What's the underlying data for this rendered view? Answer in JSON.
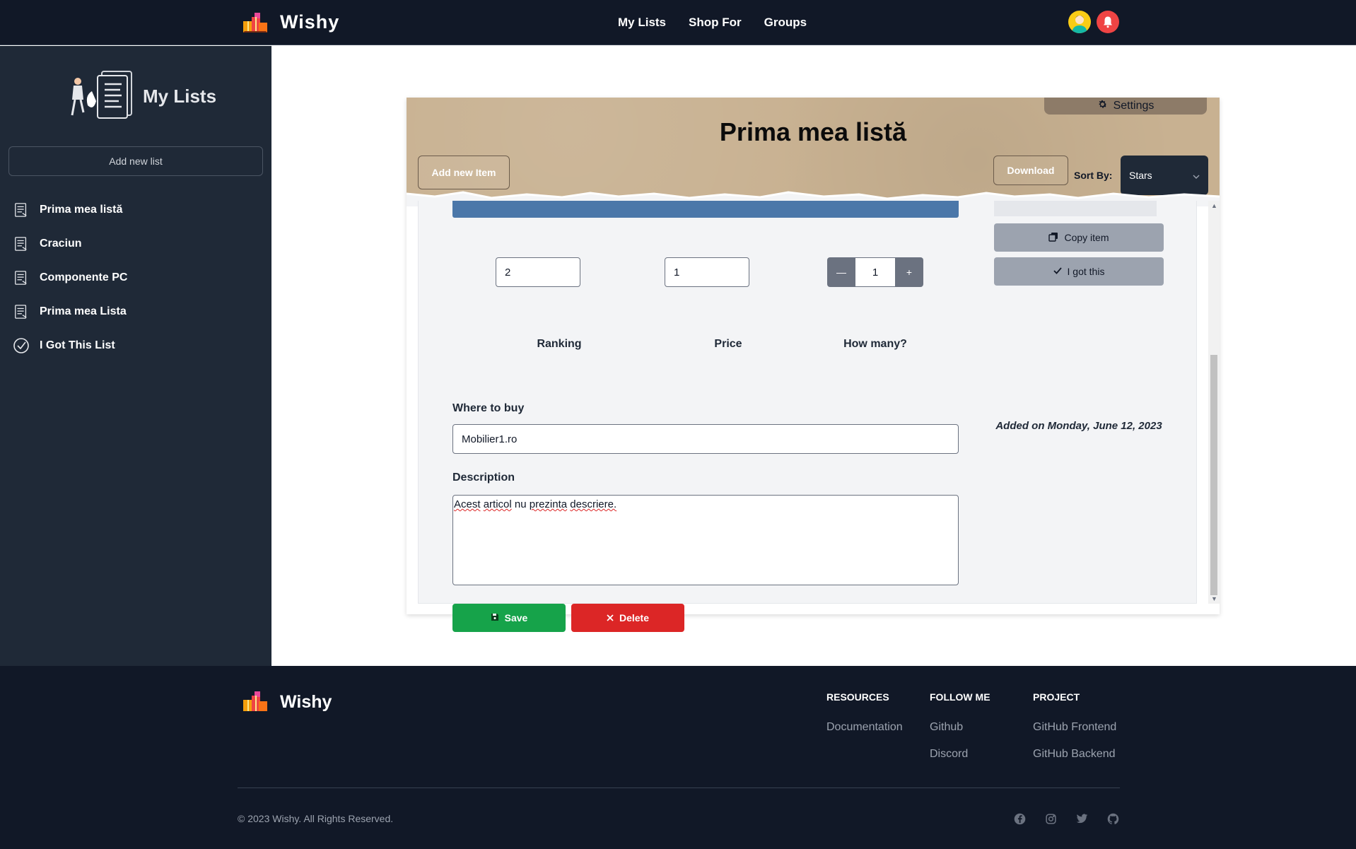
{
  "navbar": {
    "brand": "Wishy",
    "links": [
      "My Lists",
      "Shop For",
      "Groups"
    ],
    "icons": [
      "user-avatar",
      "bell-icon"
    ]
  },
  "sidebar": {
    "title": "My Lists",
    "add_label": "Add new list",
    "items": [
      {
        "label": "Prima mea listă",
        "icon": "list-icon"
      },
      {
        "label": "Craciun",
        "icon": "list-icon"
      },
      {
        "label": "Componente PC",
        "icon": "list-icon"
      },
      {
        "label": "Prima mea Lista",
        "icon": "list-icon"
      },
      {
        "label": "I Got This List",
        "icon": "check-circle-icon"
      }
    ]
  },
  "list": {
    "title": "Prima mea listă",
    "settings_label": "Settings",
    "add_item_label": "Add new Item",
    "download_label": "Download",
    "sort_label": "Sort By:",
    "sort_value": "Stars"
  },
  "item": {
    "ranking_label": "Ranking",
    "ranking_value": "2",
    "price_label": "Price",
    "price_value": "1",
    "quantity_label": "How many?",
    "quantity_value": "1",
    "minus_label": "—",
    "plus_label": "+",
    "where_label": "Where to buy",
    "where_value": "Mobilier1.ro",
    "description_label": "Description",
    "description_words": [
      "Acest",
      "articol",
      "nu",
      "prezinta",
      "descriere."
    ],
    "save_label": "Save",
    "delete_label": "Delete",
    "copy_label": "Copy item",
    "got_label": "I got this",
    "added_on": "Added on Monday, June 12, 2023"
  },
  "footer": {
    "brand": "Wishy",
    "columns": [
      {
        "heading": "RESOURCES",
        "links": [
          "Documentation"
        ]
      },
      {
        "heading": "FOLLOW ME",
        "links": [
          "Github",
          "Discord"
        ]
      },
      {
        "heading": "PROJECT",
        "links": [
          "GitHub Frontend",
          "GitHub Backend"
        ]
      }
    ],
    "copyright": "© 2023 Wishy. All Rights Reserved.",
    "social_icons": [
      "facebook-icon",
      "instagram-icon",
      "twitter-icon",
      "github-icon"
    ]
  },
  "colors": {
    "nav_bg": "#111827",
    "sidebar_bg": "#1f2937",
    "header_paper": "#c8b191",
    "save": "#16a34a",
    "delete": "#dc2626",
    "accent_bar": "#4b77a9"
  }
}
